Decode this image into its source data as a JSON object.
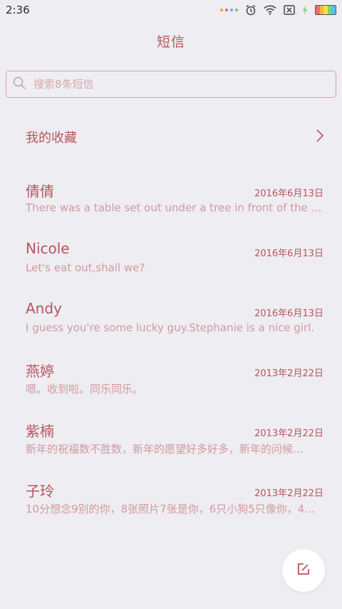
{
  "status_bar": {
    "time": "2:36",
    "icons": [
      "notification-dots-icon",
      "alarm-icon",
      "wifi-icon",
      "no-sim-icon",
      "charging-icon",
      "battery-icon"
    ]
  },
  "header": {
    "title": "短信"
  },
  "search": {
    "placeholder": "搜索8条短信",
    "value": ""
  },
  "favorites": {
    "label": "我的收藏"
  },
  "conversations": [
    {
      "name": "倩倩",
      "date": "2016年6月13日",
      "preview": "There was a table set out under a tree in front of the ho..."
    },
    {
      "name": "Nicole",
      "date": "2016年6月13日",
      "preview": "Let's eat out,shall we?"
    },
    {
      "name": "Andy",
      "date": "2016年6月13日",
      "preview": "I guess you're some lucky guy.Stephanie is a nice girl."
    },
    {
      "name": "燕婷",
      "date": "2013年2月22日",
      "preview": "嗯。收到啦。同乐同乐。"
    },
    {
      "name": "紫楠",
      "date": "2013年2月22日",
      "preview": "新年的祝福数不胜数，新年的愿望好多好多，新年的问候..."
    },
    {
      "name": "子玲",
      "date": "2013年2月22日",
      "preview": "10分想念9别的你，8张照片7张是你，6只小狗5只像你，4..."
    }
  ],
  "colors": {
    "background": "#eeedf2",
    "accent": "#b5565d",
    "preview_text": "#cf9a9e",
    "search_border": "#d9a0a4"
  }
}
